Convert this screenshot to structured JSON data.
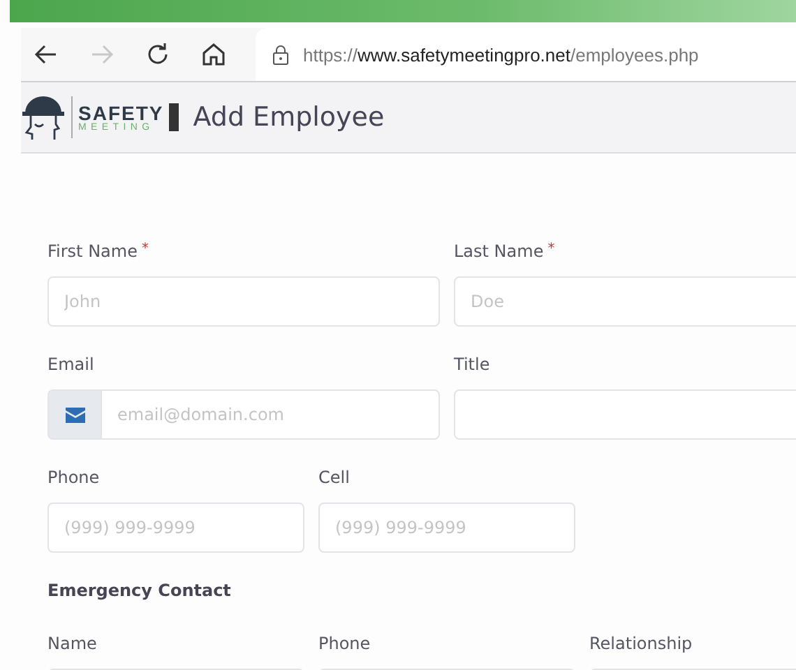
{
  "browser": {
    "url": {
      "scheme": "https://",
      "host": "www.safetymeetingpro.net",
      "path": "/employees.php"
    },
    "forward_disabled": true
  },
  "header": {
    "logo": {
      "line1": "SAFETY",
      "line2": "MEETING"
    },
    "title": "Add Employee"
  },
  "name_fields": [
    {
      "label": "First Name",
      "required_mark": "*",
      "placeholder": "John"
    },
    {
      "label": "Last Name",
      "required_mark": "*",
      "placeholder": "Doe"
    }
  ],
  "contact_fields": [
    {
      "label": "Email",
      "placeholder": "email@domain.com",
      "kind": "email"
    },
    {
      "label": "Title"
    }
  ],
  "phone_fields": [
    {
      "label": "Phone",
      "placeholder": "(999) 999-9999"
    },
    {
      "label": "Cell",
      "placeholder": "(999) 999-9999"
    }
  ],
  "section": {
    "title": "Emergency Contact",
    "fields": [
      {
        "label": "Name"
      },
      {
        "label": "Phone"
      },
      {
        "label": "Relationship"
      }
    ]
  }
}
